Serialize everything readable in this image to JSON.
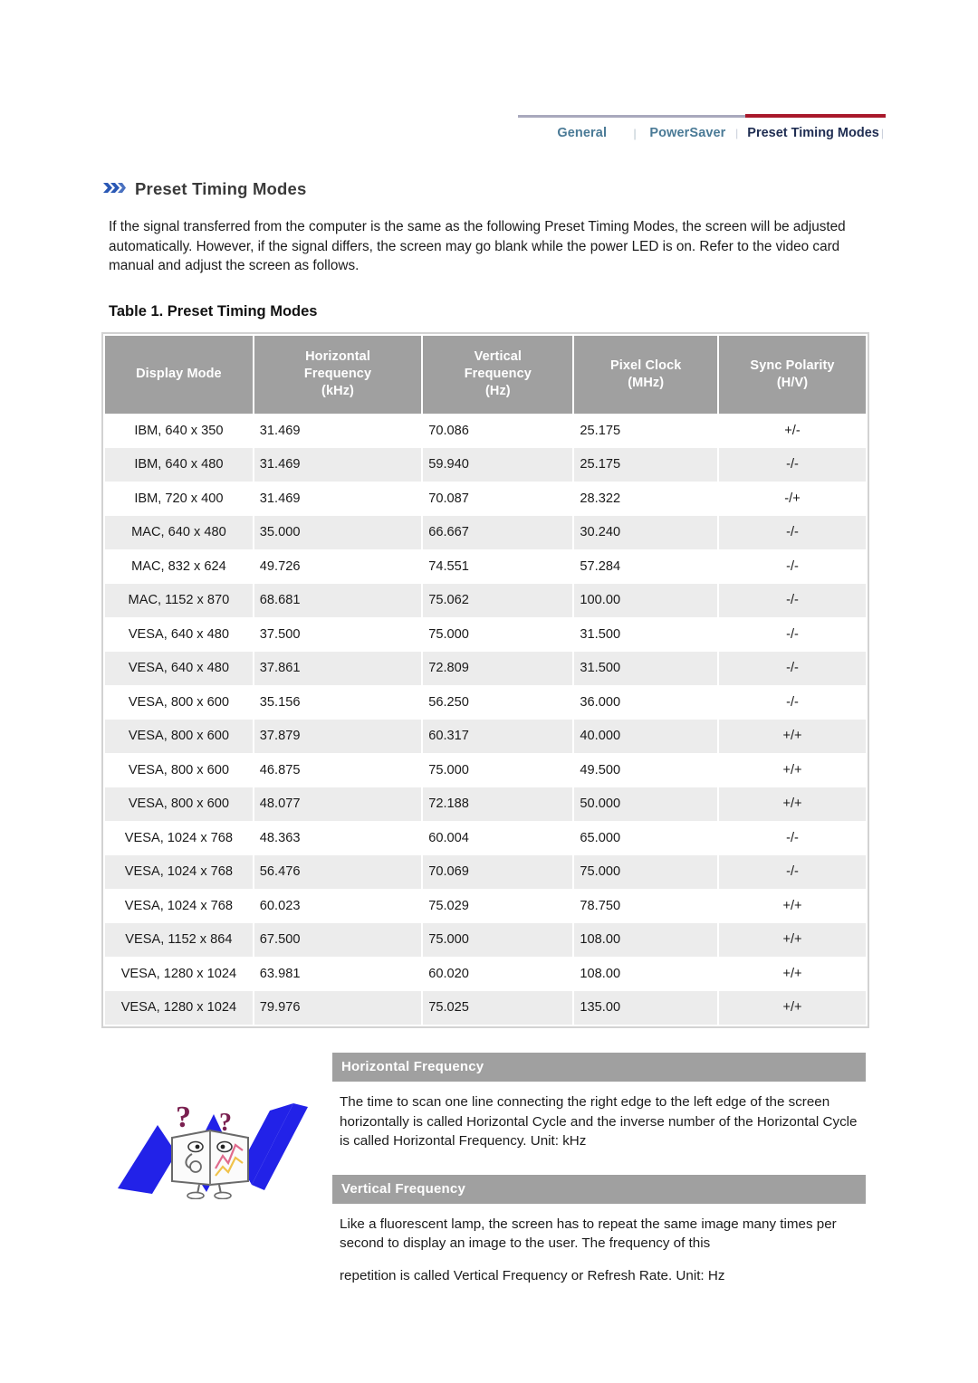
{
  "topnav": {
    "links": [
      {
        "label": "General",
        "active": false
      },
      {
        "label": "PowerSaver",
        "active": false
      },
      {
        "label": "Preset Timing Modes",
        "active": true
      }
    ],
    "separator": "|",
    "tick_left": "|",
    "tick_right": "|",
    "colors": {
      "rule_plain": "#a9a9bd",
      "rule_active": "#a9182b",
      "link": "#4a7a96",
      "link_active": "#1f2d52"
    }
  },
  "page": {
    "title": "Preset Timing Modes",
    "title_icon": "double-chevron-icon",
    "intro": "If the signal transferred from the computer is the same as the following Preset Timing Modes, the screen will be adjusted automatically. However, if the signal differs, the screen may go blank while the power LED is on. Refer to the video card manual and adjust the screen as follows."
  },
  "table": {
    "caption": "Table 1. Preset Timing Modes",
    "header_bg": "#a0a0a0",
    "stripe_bg": "#ececec",
    "columns": [
      "Display Mode",
      "Horizontal\nFrequency\n(kHz)",
      "Vertical\nFrequency\n(Hz)",
      "Pixel Clock\n(MHz)",
      "Sync Polarity\n(H/V)"
    ],
    "columns_lines": [
      [
        "Display Mode"
      ],
      [
        "Horizontal",
        "Frequency",
        "(kHz)"
      ],
      [
        "Vertical",
        "Frequency",
        "(Hz)"
      ],
      [
        "Pixel Clock",
        "(MHz)"
      ],
      [
        "Sync Polarity",
        "(H/V)"
      ]
    ],
    "rows": [
      [
        "IBM, 640 x 350",
        "31.469",
        "70.086",
        "25.175",
        "+/-"
      ],
      [
        "IBM, 640 x 480",
        "31.469",
        "59.940",
        "25.175",
        "-/-"
      ],
      [
        "IBM, 720 x 400",
        "31.469",
        "70.087",
        "28.322",
        "-/+"
      ],
      [
        "MAC, 640 x 480",
        "35.000",
        "66.667",
        "30.240",
        "-/-"
      ],
      [
        "MAC, 832 x 624",
        "49.726",
        "74.551",
        "57.284",
        "-/-"
      ],
      [
        "MAC, 1152 x 870",
        "68.681",
        "75.062",
        "100.00",
        "-/-"
      ],
      [
        "VESA, 640 x 480",
        "37.500",
        "75.000",
        "31.500",
        "-/-"
      ],
      [
        "VESA, 640 x 480",
        "37.861",
        "72.809",
        "31.500",
        "-/-"
      ],
      [
        "VESA, 800 x 600",
        "35.156",
        "56.250",
        "36.000",
        "-/-"
      ],
      [
        "VESA, 800 x 600",
        "37.879",
        "60.317",
        "40.000",
        "+/+"
      ],
      [
        "VESA, 800 x 600",
        "46.875",
        "75.000",
        "49.500",
        "+/+"
      ],
      [
        "VESA, 800 x 600",
        "48.077",
        "72.188",
        "50.000",
        "+/+"
      ],
      [
        "VESA, 1024 x 768",
        "48.363",
        "60.004",
        "65.000",
        "-/-"
      ],
      [
        "VESA, 1024 x 768",
        "56.476",
        "70.069",
        "75.000",
        "-/-"
      ],
      [
        "VESA, 1024 x 768",
        "60.023",
        "75.029",
        "78.750",
        "+/+"
      ],
      [
        "VESA, 1152 x 864",
        "67.500",
        "75.000",
        "108.00",
        "+/+"
      ],
      [
        "VESA, 1280 x 1024",
        "63.981",
        "60.020",
        "108.00",
        "+/+"
      ],
      [
        "VESA, 1280 x 1024",
        "79.976",
        "75.025",
        "135.00",
        "+/+"
      ]
    ]
  },
  "info": {
    "horizontal": {
      "heading": "Horizontal Frequency",
      "body": "The time to scan one line connecting the right edge to the left edge of the screen horizontally is called Horizontal Cycle and the inverse number of the Horizontal Cycle is called Horizontal Frequency. Unit: kHz"
    },
    "vertical": {
      "heading": "Vertical Frequency",
      "body_1": "Like a fluorescent lamp, the screen has to repeat the same image many times per second to display an image to the user. The frequency of this",
      "body_2": "repetition is called Vertical Frequency or Refresh Rate. Unit: Hz"
    }
  },
  "illustration": {
    "name": "puzzled-book-character-illustration",
    "accent_color": "#2222e8"
  }
}
